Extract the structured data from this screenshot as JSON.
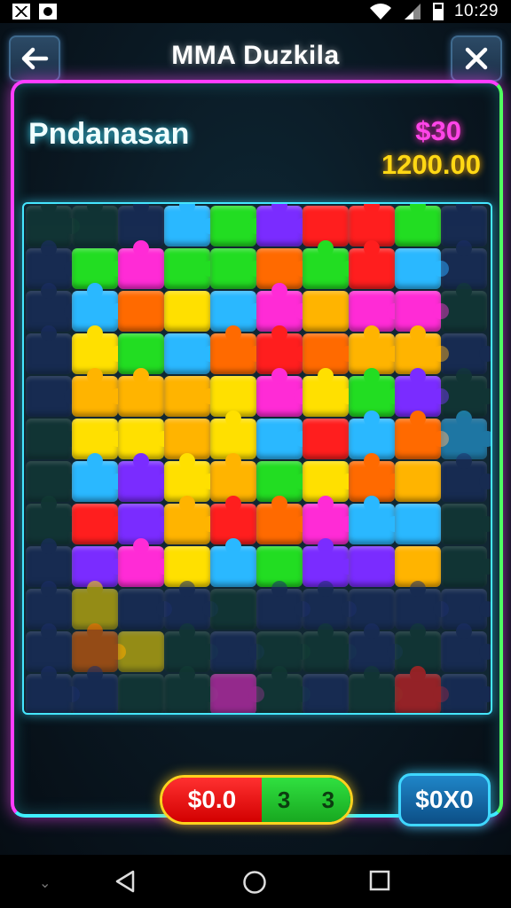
{
  "status_bar": {
    "time": "10:29"
  },
  "header": {
    "title": "MMA Duzkila",
    "back_icon": "arrow-left-icon",
    "close_icon": "close-icon"
  },
  "player": {
    "name": "Pndanasan",
    "stat_pink": "$30",
    "stat_yellow": "1200.00"
  },
  "footer": {
    "score_left": "$0.0",
    "score_right": "3 3",
    "coin_button": "$0X0"
  },
  "colors": {
    "frame_pink": "#ff3dff",
    "frame_green": "#50ff60",
    "frame_cyan": "#3ff0ff",
    "puzzle_palette": [
      "#ff1e1e",
      "#22dd22",
      "#ff2bd6",
      "#ffb400",
      "#7a2cff",
      "#2ab8ff",
      "#ff6a00",
      "#ffe000",
      "#1a3a8a",
      "#0f4a3a"
    ]
  }
}
